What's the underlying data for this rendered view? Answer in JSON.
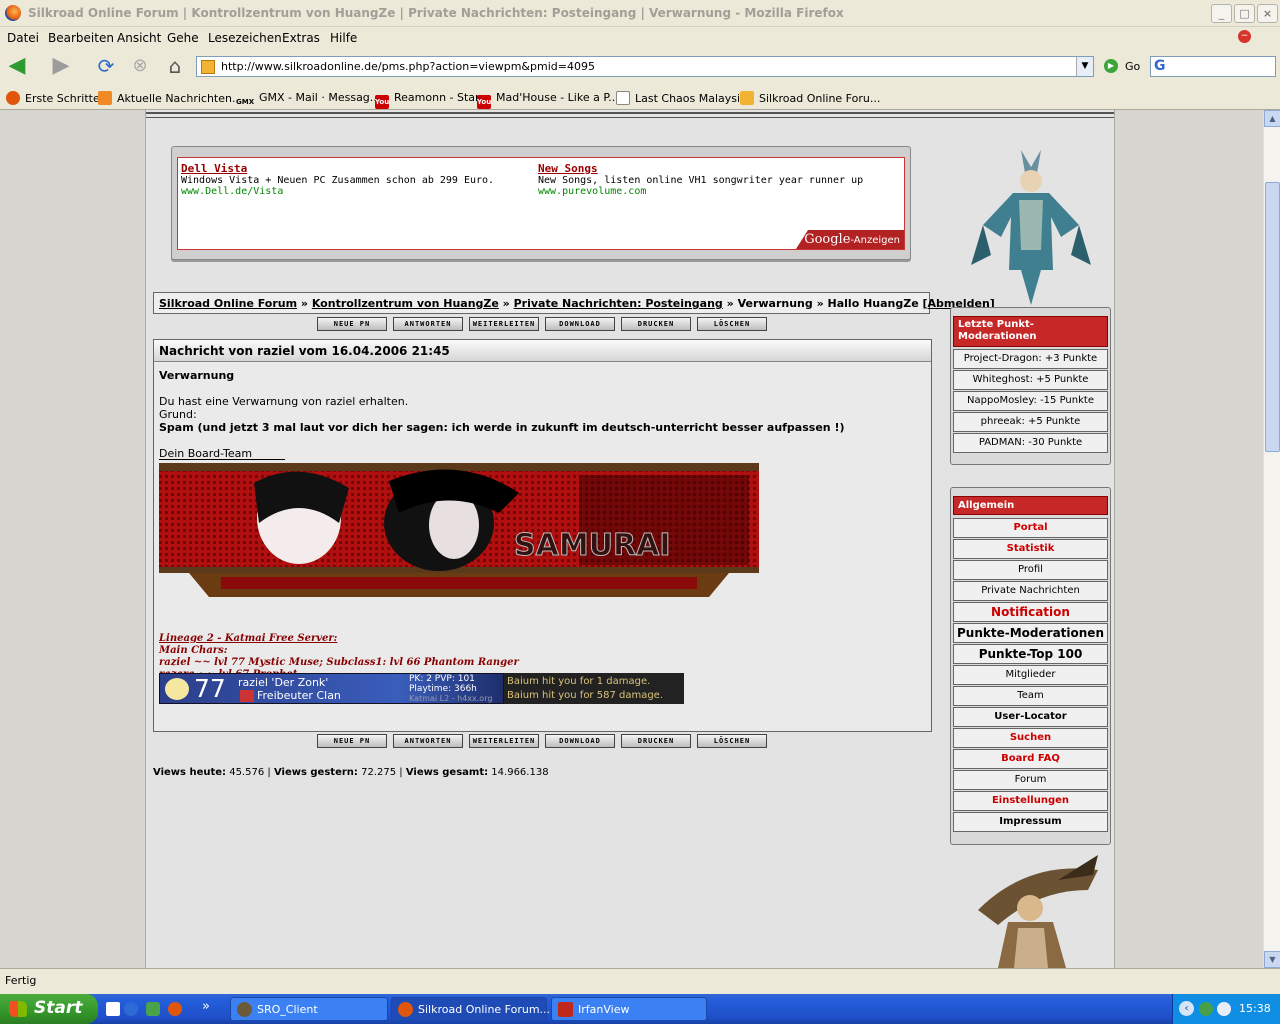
{
  "window": {
    "title": "Silkroad Online Forum | Kontrollzentrum von HuangZe | Private Nachrichten: Posteingang | Verwarnung - Mozilla Firefox",
    "minimize": "_",
    "maximize": "□",
    "close": "×"
  },
  "menu": [
    "Datei",
    "Bearbeiten",
    "Ansicht",
    "Gehe",
    "Lesezeichen",
    "Extras",
    "Hilfe"
  ],
  "nav": {
    "url": "http://www.silkroadonline.de/pms.php?action=viewpm&pmid=4095",
    "go": "Go",
    "search_logo": "G"
  },
  "bookmarks": [
    {
      "label": "Erste Schritte",
      "icon": "firefox-icon",
      "color": "#e0560d",
      "glyph": ""
    },
    {
      "label": "Aktuelle Nachrichten...",
      "icon": "rss-icon",
      "color": "#f08a24",
      "glyph": ""
    },
    {
      "label": "GMX - Mail · Messag...",
      "icon": "gmx-icon",
      "color": "#ece9d8",
      "glyph": "GMX"
    },
    {
      "label": "Reamonn - Star",
      "icon": "youtube-icon",
      "color": "#c00",
      "glyph": "You"
    },
    {
      "label": "Mad'House - Like a P...",
      "icon": "youtube-icon",
      "color": "#c00",
      "glyph": "You"
    },
    {
      "label": "Last Chaos Malaysia",
      "icon": "page-icon",
      "color": "#fff",
      "glyph": ""
    },
    {
      "label": "Silkroad Online Foru...",
      "icon": "forum-icon",
      "color": "#f2b233",
      "glyph": ""
    }
  ],
  "ads": [
    {
      "title": "Dell Vista",
      "desc": "Windows Vista + Neuen PC Zusammen schon ab 299 Euro.",
      "url": "www.Dell.de/Vista"
    },
    {
      "title": "New Songs",
      "desc": "New Songs, listen online VH1 songwriter year runner up",
      "url": "www.purevolume.com"
    }
  ],
  "google": {
    "brand": "Google",
    "suffix": "-Anzeigen"
  },
  "breadcrumb": {
    "forum": "Silkroad Online Forum",
    "sep": " » ",
    "control": "Kontrollzentrum von HuangZe",
    "inbox": "Private Nachrichten: Posteingang",
    "current": "Verwarnung",
    "hello": "Hallo HuangZe [",
    "logout": "Abmelden",
    "close": "]"
  },
  "pm_buttons": [
    "NEUE PN",
    "ANTWORTEN",
    "WEITERLEITEN",
    "DOWNLOAD",
    "DRUCKEN",
    "LÖSCHEN"
  ],
  "message": {
    "header": "Nachricht von raziel vom 16.04.2006 21:45",
    "subject": "Verwarnung",
    "line1": "Du hast eine Verwarnung von raziel erhalten.",
    "line2": "Grund:",
    "reason": "Spam (und jetzt 3 mal laut vor dich her sagen: ich werde in zukunft im deutsch-unterricht besser aufpassen !)",
    "closing": "Dein Board-Team"
  },
  "signature": {
    "banner_text": "SAMURAI",
    "server": "Lineage 2 - Katmai Free Server:",
    "main": "Main Chars:",
    "char1": "raziel ~~ lvl 77 Mystic Muse; Subclass1: lvl 66 Phantom Ranger",
    "char2": "razara ~~ lvl 67 Prophet",
    "level": "77",
    "name": "raziel 'Der Zonk'",
    "clan": "Freibeuter Clan",
    "pk": "PK: 2  PVP: 101",
    "playtime": "Playtime: 366h",
    "server_small": "Katmai L2 - h4xx.org",
    "dmg1": "Baium hit you for 1 damage.",
    "dmg2": "Baium hit you for 587 damage."
  },
  "views": {
    "today_label": "Views heute:",
    "today": " 45.576 ",
    "yesterday_label": "Views gestern:",
    "yesterday": " 72.275 ",
    "total_label": "Views gesamt:",
    "total": " 14.966.138",
    "sep": "|"
  },
  "sidebar": {
    "mod_title": "Letzte Punkt-Moderationen",
    "mods": [
      "Project-Dragon: +3 Punkte",
      "Whiteghost: +5 Punkte",
      "NappoMosley: -15 Punkte",
      "phreeak: +5 Punkte",
      "PADMAN: -30 Punkte"
    ],
    "menu_title": "Allgemein",
    "menu": [
      {
        "label": "Portal",
        "color": "#c00",
        "bold": true,
        "size": "10px"
      },
      {
        "label": "Statistik",
        "color": "#c00",
        "bold": true,
        "size": "10px"
      },
      {
        "label": "Profil",
        "color": "#000",
        "bold": false,
        "size": "10px"
      },
      {
        "label": "Private Nachrichten",
        "color": "#000",
        "bold": false,
        "size": "10px"
      },
      {
        "label": "Notification",
        "color": "#c00",
        "bold": true,
        "size": "12px"
      },
      {
        "label": "Punkte-Moderationen",
        "color": "#000",
        "bold": true,
        "size": "12px"
      },
      {
        "label": "Punkte-Top 100",
        "color": "#000",
        "bold": true,
        "size": "12px"
      },
      {
        "label": "Mitglieder",
        "color": "#000",
        "bold": false,
        "size": "10px"
      },
      {
        "label": "Team",
        "color": "#000",
        "bold": false,
        "size": "10px"
      },
      {
        "label": "User-Locator",
        "color": "#000",
        "bold": true,
        "size": "10px"
      },
      {
        "label": "Suchen",
        "color": "#c00",
        "bold": true,
        "size": "10px"
      },
      {
        "label": "Board FAQ",
        "color": "#c00",
        "bold": true,
        "size": "10px"
      },
      {
        "label": "Forum",
        "color": "#000",
        "bold": false,
        "size": "10px"
      },
      {
        "label": "Einstellungen",
        "color": "#c00",
        "bold": true,
        "size": "10px"
      },
      {
        "label": "Impressum",
        "color": "#000",
        "bold": true,
        "size": "10px"
      }
    ]
  },
  "status": "Fertig",
  "taskbar": {
    "start": "Start",
    "tasks": [
      {
        "label": "SRO_Client",
        "color": "#6b5a3a"
      },
      {
        "label": "Silkroad Online Forum...",
        "color": "#e0560d"
      },
      {
        "label": "IrfanView",
        "color": "#c0281c"
      }
    ],
    "chevron": "»",
    "clock": "15:38"
  }
}
